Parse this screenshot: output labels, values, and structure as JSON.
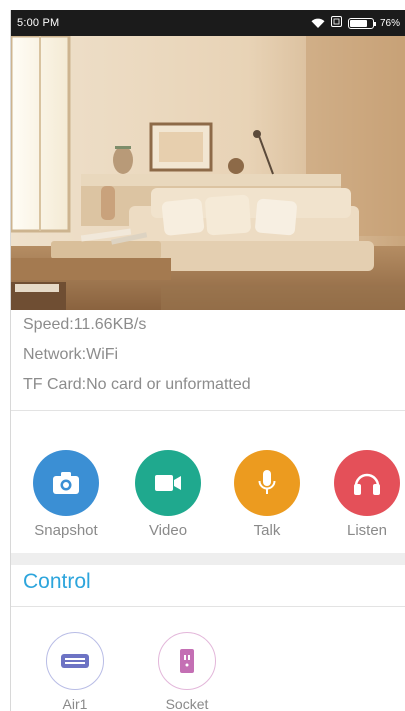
{
  "status_bar": {
    "time": "5:00 PM",
    "battery": "76%",
    "battery_level": 0.76
  },
  "camera": {
    "name": "camera-live-view"
  },
  "info": {
    "speed": "Speed:11.66KB/s",
    "network": "Network:WiFi",
    "tf_card": "TF Card:No card or unformatted"
  },
  "actions": [
    {
      "label": "Snapshot",
      "icon": "camera-icon",
      "color": "#3b8fd4"
    },
    {
      "label": "Video",
      "icon": "video-icon",
      "color": "#1fa98e"
    },
    {
      "label": "Talk",
      "icon": "microphone-icon",
      "color": "#ec9b1f"
    },
    {
      "label": "Listen",
      "icon": "headphones-icon",
      "color": "#e45059"
    }
  ],
  "control": {
    "title": "Control",
    "devices": [
      {
        "label": "Air1",
        "icon": "air-conditioner-icon",
        "color": "#6d73c4"
      },
      {
        "label": "Socket",
        "icon": "socket-icon",
        "color": "#c46fb4"
      }
    ]
  }
}
